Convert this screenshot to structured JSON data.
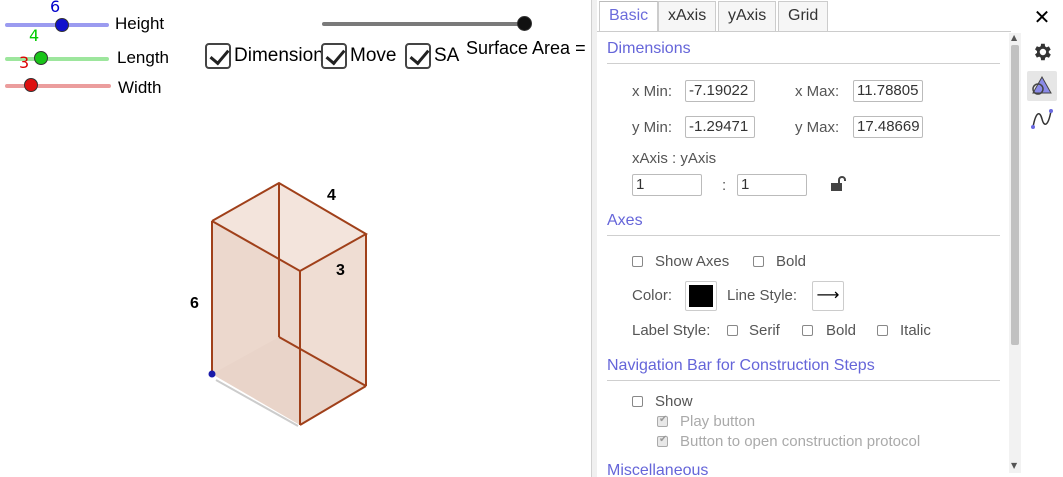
{
  "sliders": [
    {
      "name": "Height",
      "value": "6",
      "color": "#0000cc"
    },
    {
      "name": "Length",
      "value": "4",
      "color": "#00cc00"
    },
    {
      "name": "Width",
      "value": "3",
      "color": "#dd0000"
    }
  ],
  "checkboxes": [
    "Dimension",
    "Move",
    "SA"
  ],
  "surface_area_label": "Surface Area =",
  "prism_labels": {
    "height": "6",
    "length": "4",
    "width": "3"
  },
  "tabs": [
    "Basic",
    "xAxis",
    "yAxis",
    "Grid"
  ],
  "dimensions": {
    "title": "Dimensions",
    "x_min_label": "x Min:",
    "x_min": "-7.19022",
    "x_max_label": "x Max:",
    "x_max": "11.78805",
    "y_min_label": "y Min:",
    "y_min": "-1.29471",
    "y_max_label": "y Max:",
    "y_max": "17.48669",
    "ratio_label": "xAxis : yAxis",
    "ratio_x": "1",
    "ratio_sep": ":",
    "ratio_y": "1"
  },
  "axes": {
    "title": "Axes",
    "show_axes": "Show Axes",
    "bold": "Bold",
    "color_label": "Color:",
    "line_style_label": "Line Style:",
    "line_style_glyph": "⟶",
    "label_style": "Label Style:",
    "serif": "Serif",
    "bold2": "Bold",
    "italic": "Italic"
  },
  "nav": {
    "title": "Navigation Bar for Construction Steps",
    "show": "Show",
    "play": "Play button",
    "protocol": "Button to open construction protocol"
  },
  "misc": {
    "title": "Miscellaneous"
  },
  "close_glyph": "✕",
  "colors": {
    "accent": "#6565d9",
    "prism": "#a0401a",
    "prism_fill": "#e9cdbf"
  }
}
